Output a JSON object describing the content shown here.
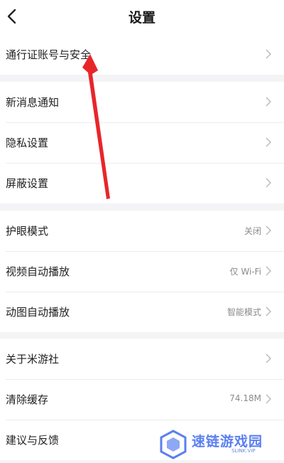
{
  "header": {
    "title": "设置"
  },
  "groups": [
    {
      "items": [
        {
          "label": "通行证账号与安全",
          "value": ""
        }
      ]
    },
    {
      "items": [
        {
          "label": "新消息通知",
          "value": ""
        },
        {
          "label": "隐私设置",
          "value": ""
        },
        {
          "label": "屏蔽设置",
          "value": ""
        }
      ]
    },
    {
      "items": [
        {
          "label": "护眼模式",
          "value": "关闭"
        },
        {
          "label": "视频自动播放",
          "value": "仅 Wi-Fi"
        },
        {
          "label": "动图自动播放",
          "value": "智能模式"
        }
      ]
    },
    {
      "items": [
        {
          "label": "关于米游社",
          "value": ""
        },
        {
          "label": "清除缓存",
          "value": "74.18M"
        },
        {
          "label": "建议与反馈",
          "value": ""
        }
      ]
    }
  ],
  "watermark": {
    "text": "速链游戏园",
    "sub": "SLINK.VIP"
  },
  "colors": {
    "annotation_arrow": "#e8262a",
    "watermark": "#5b7ff0",
    "background": "#f4f4f6"
  },
  "icons": {
    "back": "chevron-left-icon",
    "row_arrow": "chevron-right-icon"
  }
}
